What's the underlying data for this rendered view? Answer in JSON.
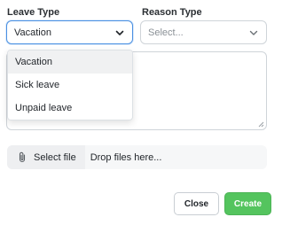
{
  "form": {
    "leave_type": {
      "label": "Leave Type",
      "value": "Vacation",
      "options": [
        "Vacation",
        "Sick leave",
        "Unpaid leave"
      ],
      "selected_index": 0
    },
    "reason_type": {
      "label": "Reason Type",
      "placeholder": "Select..."
    },
    "attachment": {
      "button_label": "Select file",
      "drop_hint": "Drop files here..."
    }
  },
  "actions": {
    "close_label": "Close",
    "create_label": "Create"
  },
  "colors": {
    "focus_border": "#4a90e2",
    "create_bg": "#54c45e",
    "selected_option_bg": "#f0f1f2"
  },
  "icons": {
    "dropdown_arrow": "chevron-down-icon",
    "attachment": "paperclip-icon",
    "resize": "resize-grip-icon"
  }
}
